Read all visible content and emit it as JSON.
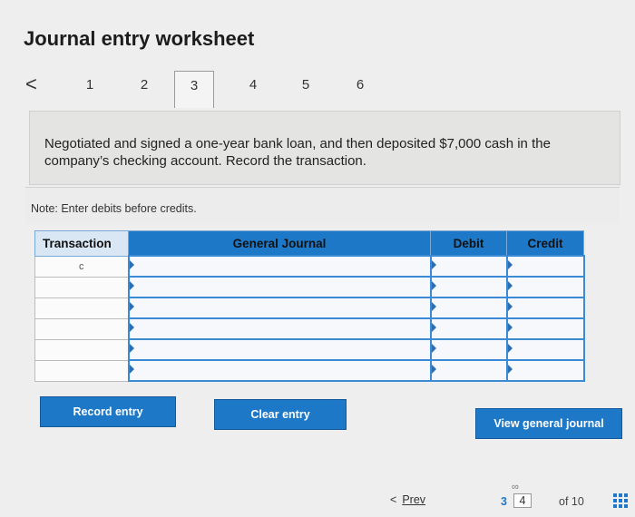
{
  "header": {
    "title": "Journal entry worksheet"
  },
  "tabs": {
    "prev_symbol": "<",
    "items": [
      "1",
      "2",
      "3",
      "4",
      "5",
      "6"
    ],
    "active": "3"
  },
  "prompt": {
    "text": "Negotiated and signed a one-year bank loan, and then deposited $7,000 cash in the company’s checking account. Record the transaction."
  },
  "note": {
    "text": "Note: Enter debits before credits."
  },
  "journal": {
    "headers": {
      "transaction": "Transaction",
      "account": "General Journal",
      "debit": "Debit",
      "credit": "Credit"
    },
    "rows": [
      {
        "transaction": "c",
        "account": "",
        "debit": "",
        "credit": ""
      },
      {
        "transaction": "",
        "account": "",
        "debit": "",
        "credit": ""
      },
      {
        "transaction": "",
        "account": "",
        "debit": "",
        "credit": ""
      },
      {
        "transaction": "",
        "account": "",
        "debit": "",
        "credit": ""
      },
      {
        "transaction": "",
        "account": "",
        "debit": "",
        "credit": ""
      },
      {
        "transaction": "",
        "account": "",
        "debit": "",
        "credit": ""
      }
    ]
  },
  "buttons": {
    "record": "Record entry",
    "clear": "Clear entry",
    "view": "View general journal"
  },
  "pager": {
    "prev_symbol": "<",
    "prev_label": "Prev",
    "current": "3",
    "selected": "4",
    "of": "of 10",
    "link_icon": "link-icon",
    "grid_icon": "grid-icon"
  },
  "colors": {
    "accent": "#1e78c8",
    "header_light": "#d9e6f3",
    "background": "#eeeeee"
  }
}
